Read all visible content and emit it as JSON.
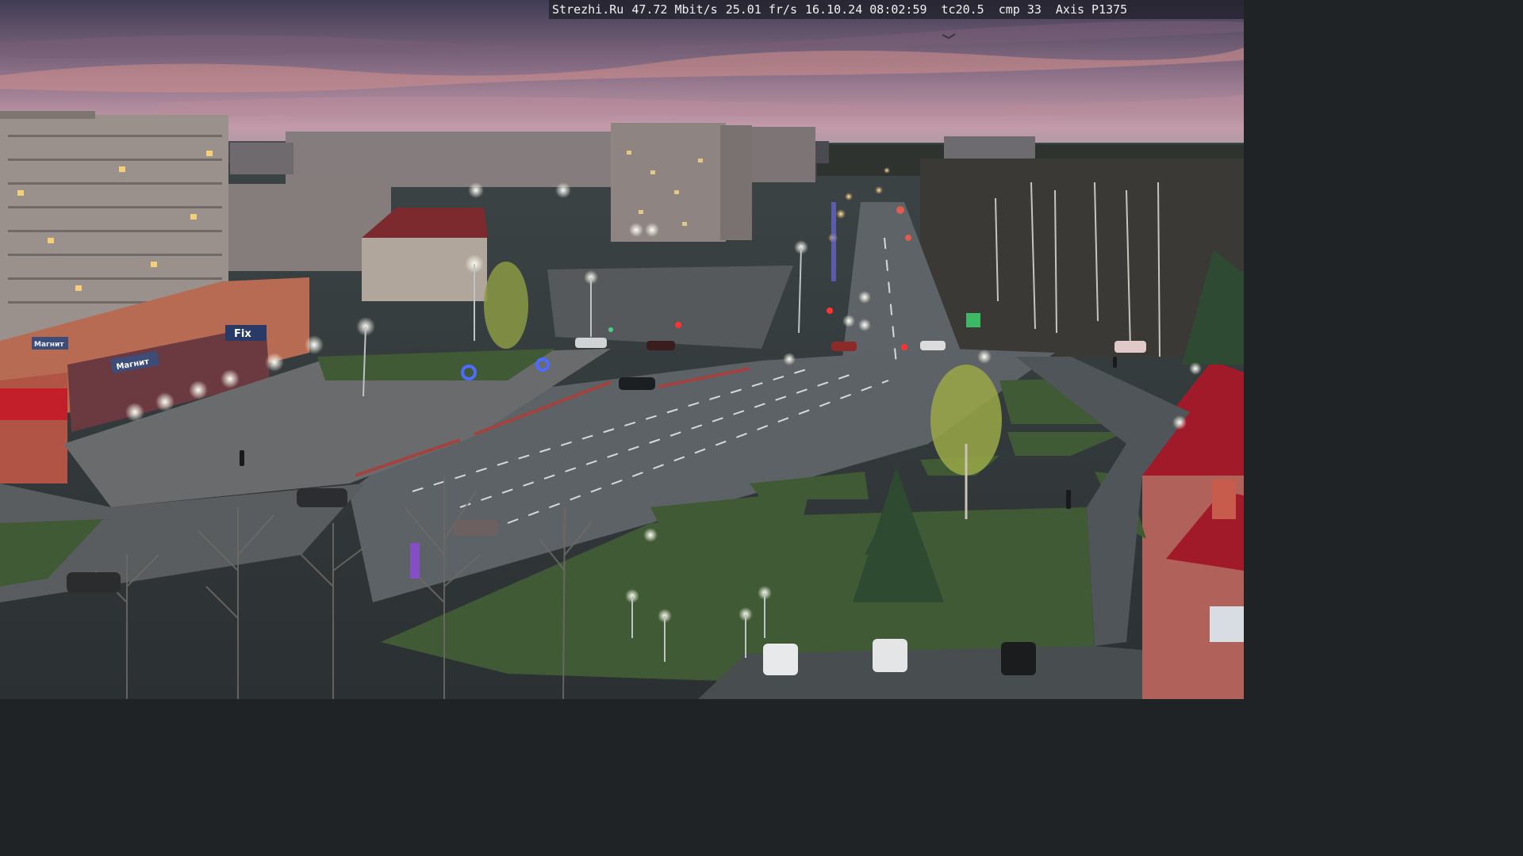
{
  "overlay": {
    "site": "Strezhi.Ru",
    "bitrate": "47.72 Mbit/s",
    "framerate": "25.01 fr/s",
    "datetime": "16.10.24 08:02:59",
    "tc": "tc20.5",
    "cmp": "cmp 33",
    "camera": "Axis P1375"
  },
  "signs": {
    "store_left": "Магнит",
    "store_mid": "Магнит",
    "store_right": "Fix"
  },
  "colors": {
    "sky_top": "#3f3b52",
    "sky_horizon": "#c99aa8",
    "road": "#5d6266",
    "grass": "#3f5a34",
    "building_brick": "#b0705a",
    "accent_red": "#c21f2a"
  }
}
